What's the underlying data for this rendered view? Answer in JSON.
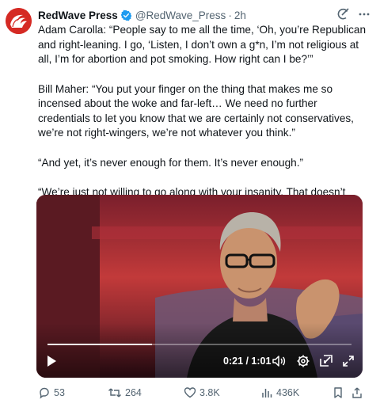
{
  "author": {
    "name": "RedWave Press",
    "handle": "@RedWave_Press",
    "separator": "·",
    "time": "2h"
  },
  "tweet": {
    "paragraphs": [
      "Adam Carolla: “People say to me all the time, ‘Oh, you’re Republican and right-leaning. I go, ‘Listen, I don’t own a g*n, I’m not religious at all, I’m for abortion and pot smoking. How right can I be?’”",
      "Bill Maher: “You put your finger on the thing that makes me so incensed about the woke and far-left… We need no further credentials to let you know that we are certainly not conservatives, we’re not right-wingers, we’re not whatever you think.”",
      "“And yet, it’s never enough for them. It’s never enough.”",
      "“We’re just not willing to go along with your insanity. That doesn’t make us conservatives.”"
    ]
  },
  "video": {
    "timecode": "0:21 / 1:01",
    "progress": 0.344
  },
  "actions": {
    "replies": "53",
    "reposts": "264",
    "likes": "3.8K",
    "views": "436K"
  },
  "colors": {
    "brand_red": "#d52a24",
    "verified_blue": "#1d9bf0",
    "muted": "#536471"
  },
  "icons": [
    "grok-icon",
    "more-icon",
    "verified-badge-icon",
    "play-icon",
    "volume-icon",
    "settings-icon",
    "pip-icon",
    "fullscreen-icon",
    "reply-icon",
    "repost-icon",
    "like-icon",
    "views-icon",
    "bookmark-icon",
    "share-icon"
  ]
}
